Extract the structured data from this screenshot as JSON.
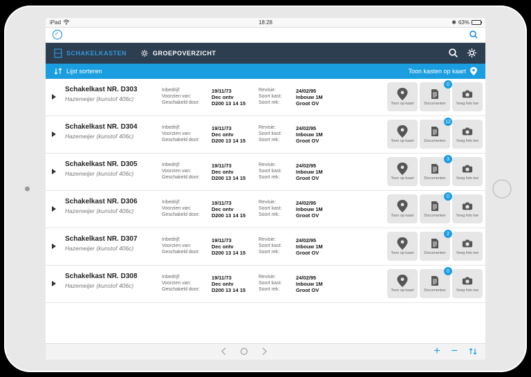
{
  "status": {
    "carrier": "iPad",
    "time": "18:28",
    "battery": "63%"
  },
  "tabs": {
    "schakelkasten": "SCHAKELKASTEN",
    "groepoverzicht": "GROEPOVERZICHT"
  },
  "sortBar": {
    "sort": "Lijst sorteren",
    "map": "Toon kasten op kaart"
  },
  "labels": {
    "inbedrijf": "Inbedrijf:",
    "voorzien": "Voorzien van:",
    "geschakeld": "Geschakeld door:",
    "revisie": "Revisie:",
    "soortKast": "Soort kast:",
    "soortRek": "Soort rek:"
  },
  "actions": {
    "map": "Toon op kaart",
    "docs": "Documenten",
    "photo": "Voeg foto toe"
  },
  "rows": [
    {
      "title": "Schakelkast NR. D303",
      "sub": "Hazemeijer (kunstof 406c)",
      "inbedrijf": "19/11/73",
      "voorzien": "Dec ontv",
      "geschakeld": "D200 13 14 15",
      "revisie": "24/02/95",
      "soortKast": "Inbouw 1M",
      "soortRek": "Groot OV",
      "badge": 0
    },
    {
      "title": "Schakelkast NR. D304",
      "sub": "Hazemeijer (kunstof 406c)",
      "inbedrijf": "19/11/73",
      "voorzien": "Dec ontv",
      "geschakeld": "D200 13 14 15",
      "revisie": "24/02/95",
      "soortKast": "Inbouw 1M",
      "soortRek": "Groot OV",
      "badge": 12
    },
    {
      "title": "Schakelkast NR. D305",
      "sub": "Hazemeijer (kunstof 406c)",
      "inbedrijf": "19/11/73",
      "voorzien": "Dec ontv",
      "geschakeld": "D200 13 14 15",
      "revisie": "24/02/95",
      "soortKast": "Inbouw 1M",
      "soortRek": "Groot OV",
      "badge": 3
    },
    {
      "title": "Schakelkast NR. D306",
      "sub": "Hazemeijer (kunstof 406c)",
      "inbedrijf": "19/11/73",
      "voorzien": "Dec ontv",
      "geschakeld": "D200 13 14 15",
      "revisie": "24/02/95",
      "soortKast": "Inbouw 1M",
      "soortRek": "Groot OV",
      "badge": 0
    },
    {
      "title": "Schakelkast NR. D307",
      "sub": "Hazemeijer (kunstof 406c)",
      "inbedrijf": "19/11/73",
      "voorzien": "Dec ontv",
      "geschakeld": "D200 13 14 15",
      "revisie": "24/02/95",
      "soortKast": "Inbouw 1M",
      "soortRek": "Groot OV",
      "badge": 2
    },
    {
      "title": "Schakelkast NR. D308",
      "sub": "Hazemeijer (kunstof 406c)",
      "inbedrijf": "19/11/73",
      "voorzien": "Dec ontv",
      "geschakeld": "D200 13 14 15",
      "revisie": "24/02/95",
      "soortKast": "Inbouw 1M",
      "soortRek": "Groot OV",
      "badge": 0
    }
  ]
}
